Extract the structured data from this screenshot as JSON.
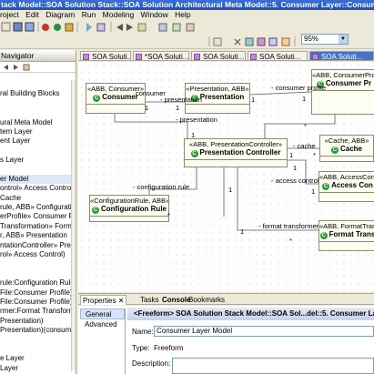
{
  "window": {
    "title": "tack Model::SOA Solution Stack::SOA Solution Architectural Meta Model::5. Consumer Layer::Consumer Layer Model - Eclip"
  },
  "menu": [
    "roject",
    "Edit",
    "Diagram",
    "Run",
    "Modeling",
    "Window",
    "Help"
  ],
  "toolbar": {
    "zoom": "95%"
  },
  "navigator": {
    "tab_label": "Navigator",
    "tree": [
      "",
      "ral Building Blocks",
      "",
      "",
      "ural Meta Model",
      "tem Layer",
      "ent Layer",
      "",
      "s Layer",
      "",
      "er Model",
      "ontrol» Access Control",
      "Cache",
      "rule, ABB» Configuration",
      "erProfile» Consumer Profil",
      "Transformation» Format Tr",
      "r, ABB» Presentation",
      "ntationController» Presentat",
      "rol» Access Control)",
      "",
      "",
      "rule:Configuration Rule)",
      "File:Consumer Profile)",
      "File:Consumer Profile)",
      "rmer:Format Transforma",
      "Presentation)",
      "Presentation)(consumer:C",
      "",
      "",
      "e Layer",
      "Layer",
      ""
    ]
  },
  "editor_tabs": [
    "SOA Soluti...",
    "*SOA Soluti...",
    "SOA Soluti...",
    "SOA Soluti...",
    "SOA Soluti..."
  ],
  "diagram": {
    "nodes": {
      "consumer": {
        "stereo": "«ABB, Consumer»",
        "name": "Consumer"
      },
      "presentation": {
        "stereo": "«Presentation, ABB»",
        "name": "Presentation"
      },
      "consumer_profile": {
        "stereo": "«ABB, ConsumerProf",
        "name": "Consumer Pr"
      },
      "presentation_controller": {
        "stereo": "«ABB, PresentationController»",
        "name": "Presentation Controller"
      },
      "cache": {
        "stereo": "«Cache, ABB»",
        "name": "Cache"
      },
      "access_control": {
        "stereo": "«ABB, AccessControl",
        "name": "Access Con"
      },
      "configuration_rule": {
        "stereo": "«ConfigurationRule, ABB»",
        "name": "Configuration Rule"
      },
      "format_transformer": {
        "stereo": "«ABB, FormatTransf",
        "name": "Format Trans"
      }
    },
    "labels": {
      "consumer_role": "consumer",
      "presentation_role": "- presentation",
      "presentation_role2": "- presentation",
      "consumer_profile_role": "- consumer profile",
      "cache_role": "- cache",
      "access_control_role": "- access control",
      "configuration_rule_role": "- configuration rule",
      "format_transformer_role": "- format transformer",
      "one": "1",
      "many": "*"
    }
  },
  "bottom_tabs": [
    "Properties",
    "Tasks",
    "Console",
    "Bookmarks"
  ],
  "properties": {
    "header": "<Freeform> SOA Solution Stack Model::SOA Sol...del::5. Consumer Layer::C",
    "sections": [
      "General",
      "Advanced"
    ],
    "name_label": "Name:",
    "name_value": "Consumer Layer Model",
    "type_label": "Type:",
    "type_value": "Freeform",
    "description_label": "Description:"
  }
}
